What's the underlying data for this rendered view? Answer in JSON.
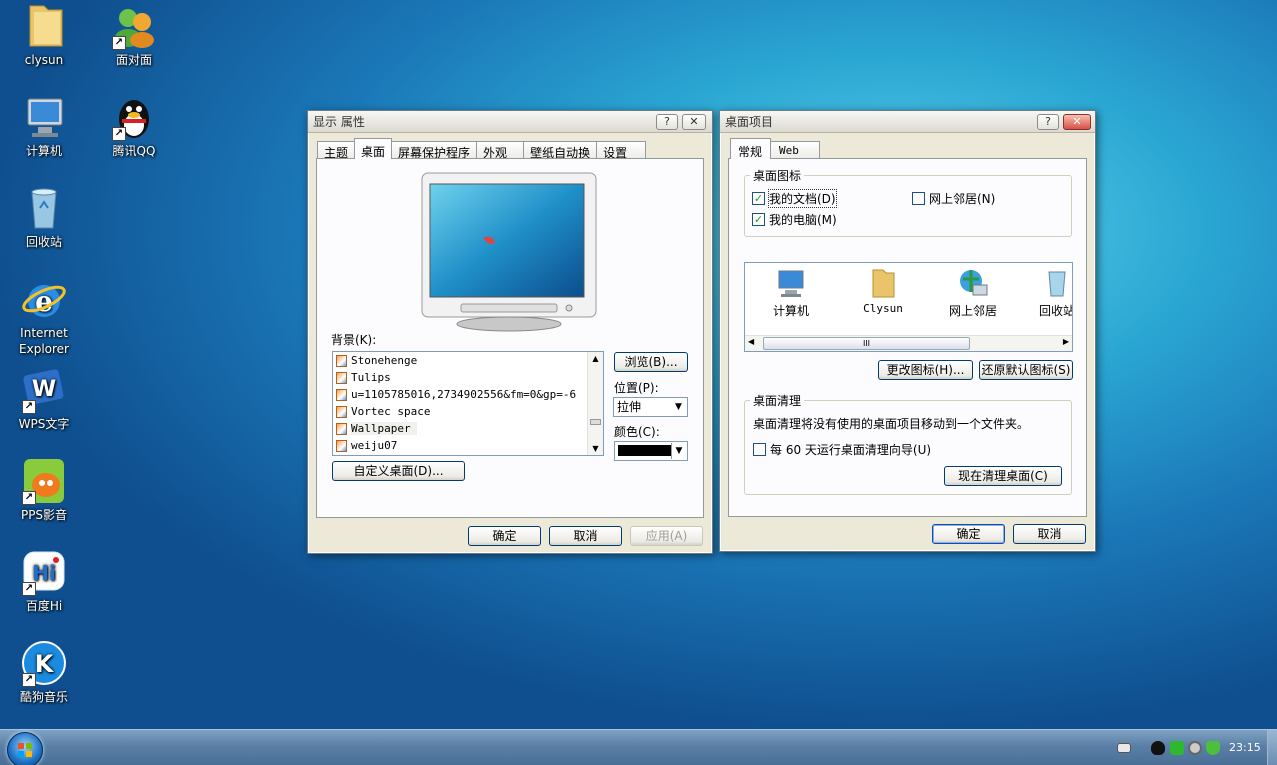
{
  "desktop": {
    "icons": [
      {
        "label": "clysun",
        "icon": "folder-icon"
      },
      {
        "label": "面对面",
        "icon": "contacts-icon"
      },
      {
        "label": "计算机",
        "icon": "computer-icon"
      },
      {
        "label": "腾讯QQ",
        "icon": "qq-penguin-icon"
      },
      {
        "label": "回收站",
        "icon": "recycle-bin-icon"
      },
      {
        "label": "Internet\nExplorer",
        "icon": "internet-explorer-icon"
      },
      {
        "label": "WPS文字",
        "icon": "wps-writer-icon"
      },
      {
        "label": "PPS影音",
        "icon": "pps-player-icon"
      },
      {
        "label": "百度Hi",
        "icon": "baidu-hi-icon"
      },
      {
        "label": "酷狗音乐",
        "icon": "kugou-music-icon"
      }
    ]
  },
  "display_dialog": {
    "title": "显示 属性",
    "help_button": "?",
    "close_button": "✕",
    "tabs": [
      "主题",
      "桌面",
      "屏幕保护程序",
      "外观",
      "壁纸自动换",
      "设置"
    ],
    "active_tab": "桌面",
    "background_label": "背景(K):",
    "background_items": [
      "Stonehenge",
      "Tulips",
      "u=1105785016,2734902556&fm=0&gp=-6",
      "Vortec space",
      "Wallpaper",
      "weiju07"
    ],
    "selected_item": "Wallpaper",
    "browse_button": "浏览(B)...",
    "position_label": "位置(P):",
    "position_value": "拉伸",
    "color_label": "颜色(C):",
    "color_value": "#000000",
    "customize_button": "自定义桌面(D)...",
    "ok_button": "确定",
    "cancel_button": "取消",
    "apply_button": "应用(A)"
  },
  "items_dialog": {
    "title": "桌面项目",
    "help_button": "?",
    "close_button": "✕",
    "tabs": [
      "常规",
      "Web"
    ],
    "active_tab": "常规",
    "icons_group_label": "桌面图标",
    "checkboxes": [
      {
        "label": "我的文档(D)",
        "checked": true
      },
      {
        "label": "网上邻居(N)",
        "checked": false
      },
      {
        "label": "我的电脑(M)",
        "checked": true
      }
    ],
    "preview_icons": [
      {
        "label": "计算机",
        "icon": "computer-icon"
      },
      {
        "label": "Clysun",
        "icon": "folder-icon"
      },
      {
        "label": "网上邻居",
        "icon": "network-icon"
      },
      {
        "label": "回收站",
        "icon": "recycle-bin-icon"
      }
    ],
    "scroll_grip": "III",
    "change_icon_button": "更改图标(H)...",
    "restore_default_button": "还原默认图标(S)",
    "cleanup_group_label": "桌面清理",
    "cleanup_description": "桌面清理将没有使用的桌面项目移动到一个文件夹。",
    "cleanup_checkbox": "每 60 天运行桌面清理向导(U)",
    "cleanup_checkbox_checked": false,
    "cleanup_now_button": "现在清理桌面(C)",
    "ok_button": "确定",
    "cancel_button": "取消"
  },
  "taskbar": {
    "clock": "23:15",
    "tray_icons": [
      "keyboard-icon",
      "qq-tray-icon",
      "wechat-tray-icon",
      "disc-tray-icon",
      "shield-tray-icon"
    ]
  }
}
